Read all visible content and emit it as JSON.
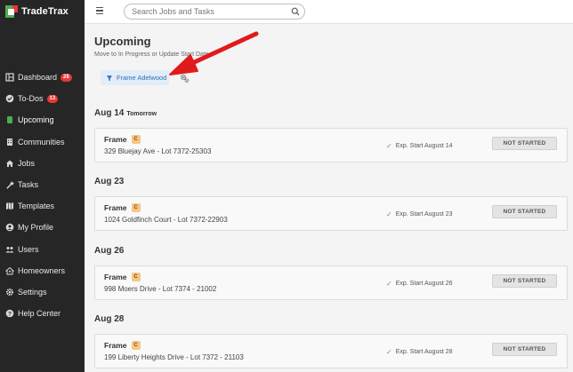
{
  "app": {
    "name": "TradeTrax"
  },
  "search": {
    "placeholder": "Search Jobs and Tasks"
  },
  "sidebar": {
    "items": [
      {
        "label": "Dashboard",
        "icon": "dashboard-icon",
        "badge": "28"
      },
      {
        "label": "To-Dos",
        "icon": "check-circle-icon",
        "badge": "13"
      },
      {
        "label": "Upcoming",
        "icon": "upcoming-icon",
        "active": true
      },
      {
        "label": "Communities",
        "icon": "building-icon"
      },
      {
        "label": "Jobs",
        "icon": "home-icon"
      },
      {
        "label": "Tasks",
        "icon": "wrench-icon"
      },
      {
        "label": "Templates",
        "icon": "map-icon"
      },
      {
        "label": "My Profile",
        "icon": "user-circle-icon"
      },
      {
        "label": "Users",
        "icon": "users-icon"
      },
      {
        "label": "Homeowners",
        "icon": "homeowner-icon"
      },
      {
        "label": "Settings",
        "icon": "gear-icon"
      },
      {
        "label": "Help Center",
        "icon": "help-icon"
      }
    ]
  },
  "main": {
    "title": "Upcoming",
    "subtitle": "Move to In Progress or Update Start Date",
    "filter": {
      "label": "Frame Adelwood"
    },
    "groups": [
      {
        "date": "Aug 14",
        "sub": "Tomorrow",
        "task": {
          "name": "Frame",
          "badge": "C",
          "address": "329 Bluejay Ave - Lot 7372-25303",
          "exp": "Exp. Start August 14",
          "status": "NOT STARTED"
        }
      },
      {
        "date": "Aug 23",
        "sub": "",
        "task": {
          "name": "Frame",
          "badge": "C",
          "address": "1024 Goldfinch Court - Lot 7372-22903",
          "exp": "Exp. Start August 23",
          "status": "NOT STARTED"
        }
      },
      {
        "date": "Aug 26",
        "sub": "",
        "task": {
          "name": "Frame",
          "badge": "C",
          "address": "998 Moers Drive - Lot 7374 - 21002",
          "exp": "Exp. Start August 26",
          "status": "NOT STARTED"
        }
      },
      {
        "date": "Aug 28",
        "sub": "",
        "task": {
          "name": "Frame",
          "badge": "C",
          "address": "199 Liberty Heights Drive - Lot 7372 - 21103",
          "exp": "Exp. Start August 28",
          "status": "NOT STARTED"
        }
      }
    ]
  },
  "colors": {
    "sidebar_bg": "#262626",
    "accent_green": "#4caf50",
    "badge_red": "#e53935",
    "filter_blue": "#2a6db8",
    "annotation_arrow": "#e01b1b"
  }
}
